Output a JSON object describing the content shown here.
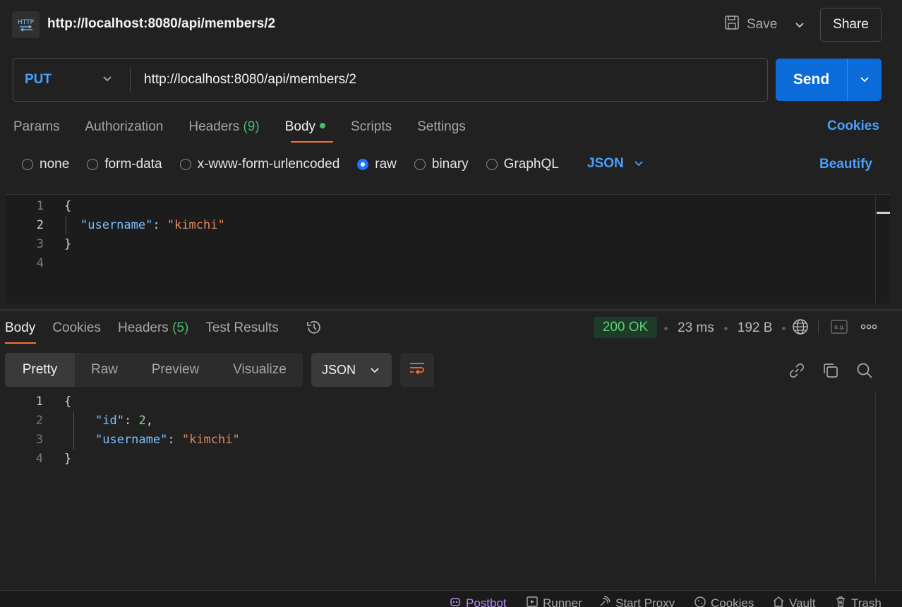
{
  "header": {
    "title": "http://localhost:8080/api/members/2",
    "save_label": "Save",
    "share_label": "Share",
    "icon": "http-icon"
  },
  "request": {
    "method": "PUT",
    "url": "http://localhost:8080/api/members/2",
    "send_label": "Send",
    "tabs": [
      {
        "label": "Params"
      },
      {
        "label": "Authorization"
      },
      {
        "label": "Headers",
        "count": "(9)"
      },
      {
        "label": "Body"
      },
      {
        "label": "Scripts"
      },
      {
        "label": "Settings"
      }
    ],
    "cookies_label": "Cookies",
    "body_options": [
      "none",
      "form-data",
      "x-www-form-urlencoded",
      "raw",
      "binary",
      "GraphQL"
    ],
    "selected_option": "raw",
    "format": "JSON",
    "beautify_label": "Beautify",
    "line_numbers": [
      "1",
      "2",
      "3",
      "4"
    ],
    "code": {
      "open": "{",
      "key": "\"username\"",
      "colon": ": ",
      "value": "\"kimchi\"",
      "close": "}"
    }
  },
  "response": {
    "tabs": [
      {
        "label": "Body"
      },
      {
        "label": "Cookies"
      },
      {
        "label": "Headers",
        "count": "(5)"
      },
      {
        "label": "Test Results"
      }
    ],
    "status": "200 OK",
    "time": "23 ms",
    "size": "192 B",
    "view_tabs": [
      "Pretty",
      "Raw",
      "Preview",
      "Visualize"
    ],
    "format": "JSON",
    "line_numbers": [
      "1",
      "2",
      "3",
      "4"
    ],
    "code": {
      "open": "{",
      "id_key": "\"id\"",
      "id_colon": ": ",
      "id_value": "2",
      "comma": ",",
      "user_key": "\"username\"",
      "user_colon": ": ",
      "user_value": "\"kimchi\"",
      "close": "}"
    }
  },
  "status_bar": {
    "postbot": "Postbot",
    "runner": "Runner",
    "start_proxy": "Start Proxy",
    "cookies": "Cookies",
    "vault": "Vault",
    "trash": "Trash"
  },
  "colors": {
    "accent": "#ff6c37",
    "link": "#4a9fff",
    "send": "#0b6cd9",
    "success": "#5fd07a"
  }
}
